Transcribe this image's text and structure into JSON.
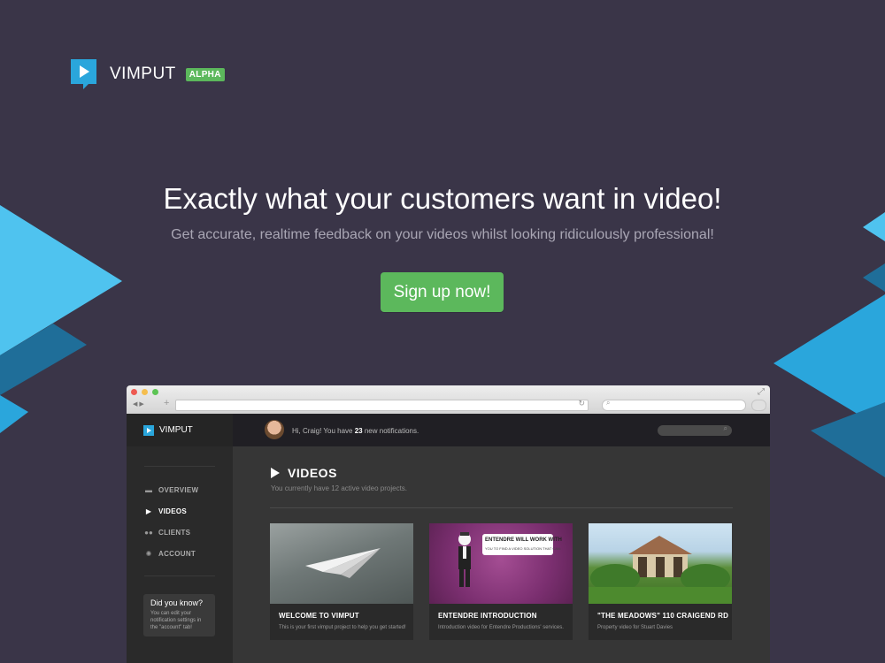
{
  "brand": {
    "name": "VIMPUT",
    "badge": "ALPHA",
    "logo_icon": "play-bubble-icon",
    "accent_color": "#2aa6dc"
  },
  "hero": {
    "title": "Exactly what your customers want in video!",
    "subtitle": "Get accurate, realtime feedback on your videos whilst looking ridiculously professional!",
    "cta_label": "Sign up now!",
    "cta_color": "#5cb85c"
  },
  "mockup": {
    "app_name": "VIMPUT",
    "topbar": {
      "greeting_prefix": "Hi, Craig! You have ",
      "notification_count": "23",
      "greeting_suffix": " new notifications."
    },
    "sidebar": {
      "items": [
        {
          "label": "OVERVIEW",
          "icon": "briefcase-icon",
          "active": false
        },
        {
          "label": "VIDEOS",
          "icon": "play-icon",
          "active": true
        },
        {
          "label": "CLIENTS",
          "icon": "users-icon",
          "active": false
        },
        {
          "label": "ACCOUNT",
          "icon": "gears-icon",
          "active": false
        }
      ],
      "tip": {
        "title": "Did you know?",
        "text": "You can edit your notification settings in the \"account\" tab!"
      }
    },
    "main": {
      "section_title": "VIDEOS",
      "section_subtitle": "You currently have 12 active video projects.",
      "cards": [
        {
          "title": "WELCOME TO VIMPUT",
          "description": "This is your first vimput project to help you get started!"
        },
        {
          "title": "ENTENDRE INTRODUCTION",
          "description": "Introduction video for Entendre Productions' services.",
          "thumb_caption": "ENTENDRE WILL WORK WITH",
          "thumb_subcaption": "YOU TO FIND A VIDEO SOLUTION THAT CAN:"
        },
        {
          "title": "\"THE MEADOWS\" 110 CRAIGEND RD",
          "description": "Property video for Stuart Davies"
        }
      ]
    }
  }
}
